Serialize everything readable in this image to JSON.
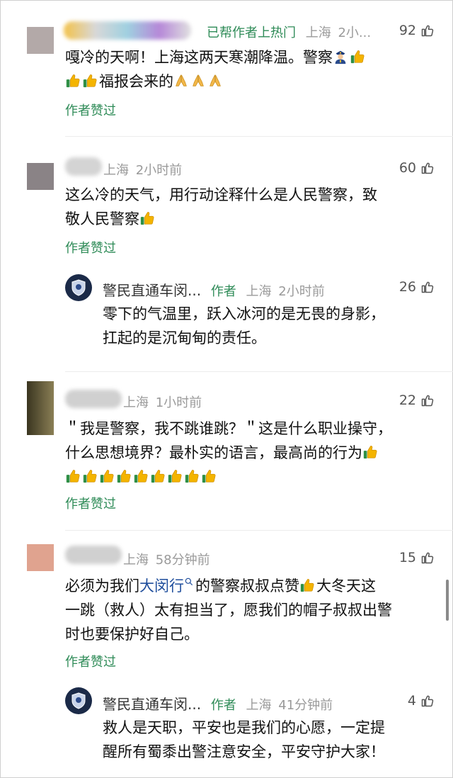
{
  "comments": [
    {
      "hot_label": "已帮作者上热门",
      "location": "上海",
      "time": "2小...",
      "likes": "92",
      "text_lines": [
        "嘎冷的天啊！上海这两天寒潮降温。警察",
        "福报会来的"
      ],
      "liked_label": "作者赞过"
    },
    {
      "location": "上海",
      "time": "2小时前",
      "likes": "60",
      "text_lines": [
        "这么冷的天气，用行动诠释什么是人民警察，致",
        "敬人民警察"
      ],
      "liked_label": "作者赞过"
    },
    {
      "location": "上海",
      "time": "1小时前",
      "likes": "22",
      "text_lines": [
        "＂我是警察，我不跳谁跳？＂这是什么职业操守，",
        "什么思想境界？最朴实的语言，最高尚的行为"
      ],
      "liked_label": "作者赞过"
    },
    {
      "location": "上海",
      "time": "58分钟前",
      "likes": "15",
      "text_prefix": "必须为我们",
      "text_link": "大闵行",
      "text_suffix": "的警察叔叔点赞",
      "text_after_emoji": "大冬天这",
      "text_lines": [
        "一跳（救人）太有担当了，愿我们的帽子叔叔出警",
        "时也要保护好自己。"
      ],
      "liked_label": "作者赞过"
    }
  ],
  "replies": [
    {
      "name": "警民直通车闵...",
      "author_tag": "作者",
      "location": "上海",
      "time": "2小时前",
      "likes": "26",
      "text_lines": [
        "零下的气温里，跃入冰河的是无畏的身影，",
        "扛起的是沉甸甸的责任。"
      ]
    },
    {
      "name": "警民直通车闵...",
      "author_tag": "作者",
      "location": "上海",
      "time": "41分钟前",
      "likes": "4",
      "text_lines": [
        "救人是天职，平安也是我们的心愿，一定提",
        "醒所有蜀黍出警注意安全，平安守护大家！"
      ]
    }
  ],
  "colors": {
    "green": "#2e8b57",
    "link": "#1f4e9c",
    "gray": "#9a9a9a"
  },
  "icons": {
    "like": "thumb-outline-icon",
    "thumbs_up_emoji": "thumbs-up-emoji",
    "pray_emoji": "pray-emoji",
    "police_emoji": "police-emoji",
    "search": "search-icon"
  }
}
